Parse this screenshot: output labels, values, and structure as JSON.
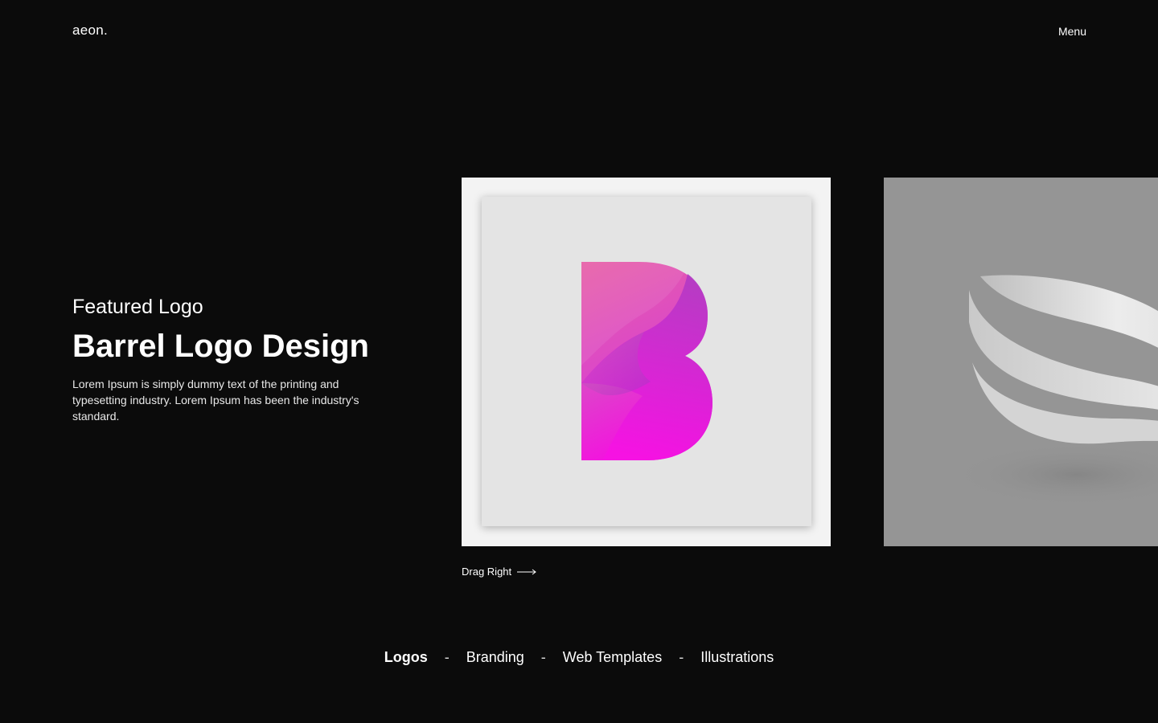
{
  "header": {
    "logo": "aeon.",
    "menu_label": "Menu"
  },
  "hero": {
    "eyebrow": "Featured Logo",
    "title": "Barrel Logo Design",
    "description": "Lorem Ipsum is simply dummy text of the printing and typesetting industry. Lorem Ipsum has been the industry's standard."
  },
  "gallery": {
    "drag_label": "Drag Right",
    "items": [
      {
        "icon": "barrel-b-logo",
        "background": "#f3f3f3",
        "accent": "#e33de0"
      },
      {
        "icon": "ribbon-s-logo",
        "background": "#959595"
      }
    ]
  },
  "categories": {
    "items": [
      {
        "label": "Logos",
        "active": true
      },
      {
        "label": "Branding",
        "active": false
      },
      {
        "label": "Web Templates",
        "active": false
      },
      {
        "label": "Illustrations",
        "active": false
      }
    ],
    "separator": "-"
  },
  "colors": {
    "background": "#0b0b0b",
    "text": "#ffffff"
  }
}
